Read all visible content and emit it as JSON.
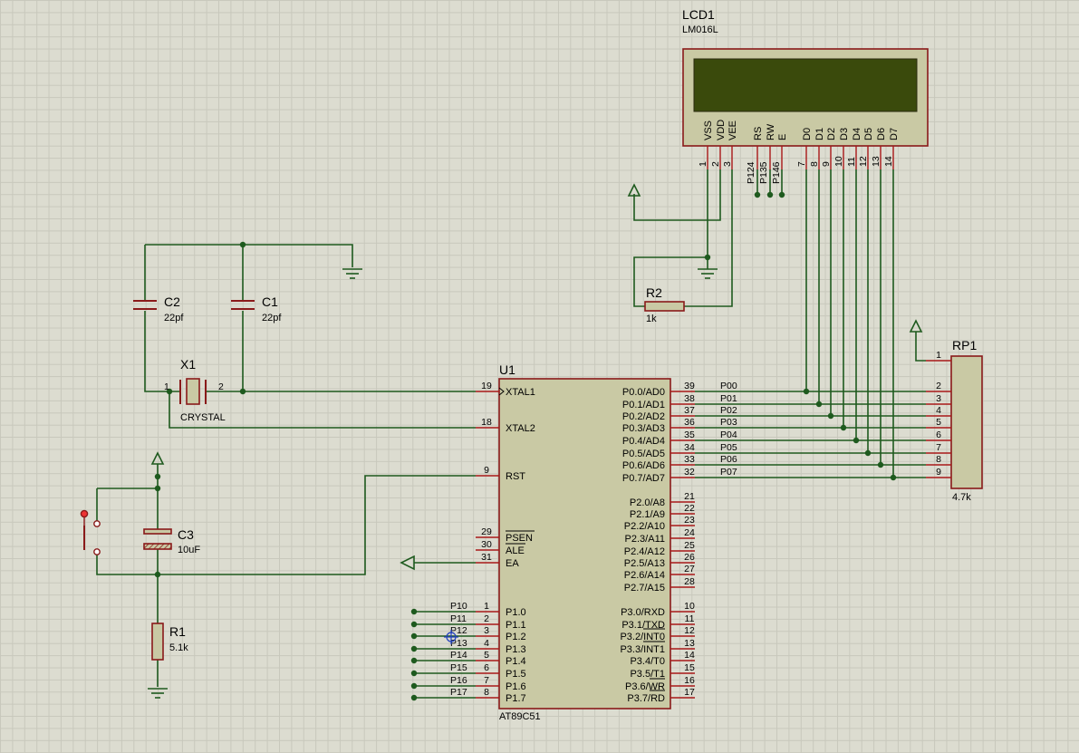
{
  "components": {
    "lcd": {
      "ref": "LCD1",
      "part": "LM016L",
      "pin_names": [
        "VSS",
        "VDD",
        "VEE",
        "RS",
        "RW",
        "E",
        "D0",
        "D1",
        "D2",
        "D3",
        "D4",
        "D5",
        "D6",
        "D7"
      ],
      "pin_numbers": [
        "1",
        "2",
        "3",
        "",
        "",
        "",
        "7",
        "8",
        "9",
        "10",
        "11",
        "12",
        "13",
        "14"
      ],
      "ctrl_nets": [
        "P124",
        "P135",
        "P146"
      ]
    },
    "u1": {
      "ref": "U1",
      "part": "AT89C51",
      "left_pins": [
        {
          "num": "19",
          "name": "XTAL1"
        },
        {
          "num": "18",
          "name": "XTAL2"
        },
        {
          "num": "9",
          "name": "RST"
        },
        {
          "num": "29",
          "name": "PSEN"
        },
        {
          "num": "30",
          "name": "ALE"
        },
        {
          "num": "31",
          "name": "EA"
        },
        {
          "num": "1",
          "name": "P1.0"
        },
        {
          "num": "2",
          "name": "P1.1"
        },
        {
          "num": "3",
          "name": "P1.2"
        },
        {
          "num": "4",
          "name": "P1.3"
        },
        {
          "num": "5",
          "name": "P1.4"
        },
        {
          "num": "6",
          "name": "P1.5"
        },
        {
          "num": "7",
          "name": "P1.6"
        },
        {
          "num": "8",
          "name": "P1.7"
        }
      ],
      "right_pins": [
        {
          "num": "39",
          "name": "P0.0/AD0"
        },
        {
          "num": "38",
          "name": "P0.1/AD1"
        },
        {
          "num": "37",
          "name": "P0.2/AD2"
        },
        {
          "num": "36",
          "name": "P0.3/AD3"
        },
        {
          "num": "35",
          "name": "P0.4/AD4"
        },
        {
          "num": "34",
          "name": "P0.5/AD5"
        },
        {
          "num": "33",
          "name": "P0.6/AD6"
        },
        {
          "num": "32",
          "name": "P0.7/AD7"
        },
        {
          "num": "21",
          "name": "P2.0/A8"
        },
        {
          "num": "22",
          "name": "P2.1/A9"
        },
        {
          "num": "23",
          "name": "P2.2/A10"
        },
        {
          "num": "24",
          "name": "P2.3/A11"
        },
        {
          "num": "25",
          "name": "P2.4/A12"
        },
        {
          "num": "26",
          "name": "P2.5/A13"
        },
        {
          "num": "27",
          "name": "P2.6/A14"
        },
        {
          "num": "28",
          "name": "P2.7/A15"
        },
        {
          "num": "10",
          "name": "P3.0/RXD"
        },
        {
          "num": "11",
          "name": "P3.1/TXD"
        },
        {
          "num": "12",
          "name": "P3.2/INT0"
        },
        {
          "num": "13",
          "name": "P3.3/INT1"
        },
        {
          "num": "14",
          "name": "P3.4/T0"
        },
        {
          "num": "15",
          "name": "P3.5/T1"
        },
        {
          "num": "16",
          "name": "P3.6/WR"
        },
        {
          "num": "17",
          "name": "P3.7/RD"
        }
      ],
      "p0_nets": [
        "P00",
        "P01",
        "P02",
        "P03",
        "P04",
        "P05",
        "P06",
        "P07"
      ],
      "p1_nets": [
        "P10",
        "P11",
        "P12",
        "P13",
        "P14",
        "P15",
        "P16",
        "P17"
      ]
    },
    "rp1": {
      "ref": "RP1",
      "value": "4.7k",
      "pin_numbers": [
        "1",
        "2",
        "3",
        "4",
        "5",
        "6",
        "7",
        "8",
        "9"
      ]
    },
    "c1": {
      "ref": "C1",
      "value": "22pf"
    },
    "c2": {
      "ref": "C2",
      "value": "22pf"
    },
    "c3": {
      "ref": "C3",
      "value": "10uF"
    },
    "x1": {
      "ref": "X1",
      "value": "CRYSTAL",
      "pin1": "1",
      "pin2": "2"
    },
    "r1": {
      "ref": "R1",
      "value": "5.1k"
    },
    "r2": {
      "ref": "R2",
      "value": "1k"
    }
  },
  "colors": {
    "wire": "#1e5a1e",
    "pin": "#a81818",
    "body_fill": "#c9c9a4",
    "body_stroke": "#8a1a1a",
    "lcd_screen": "#3a4a0c"
  }
}
